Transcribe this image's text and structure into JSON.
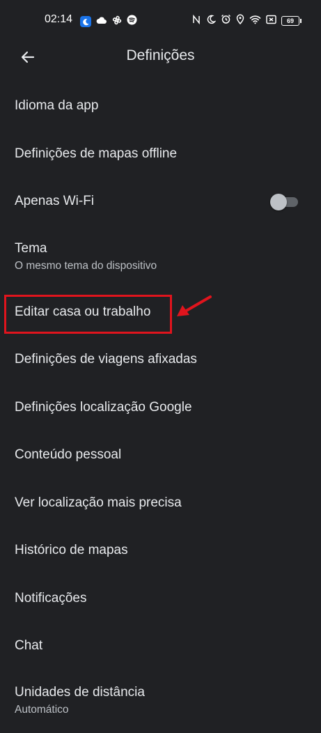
{
  "status_bar": {
    "time": "02:14",
    "battery": "69",
    "left_icons": [
      "moon-icon",
      "cloud-icon",
      "fan-icon",
      "spotify-icon"
    ],
    "right_icons": [
      "nfc-icon",
      "do-not-disturb-icon",
      "alarm-icon",
      "location-icon",
      "wifi-icon",
      "sim-icon",
      "battery-icon"
    ]
  },
  "app_bar": {
    "title": "Definições",
    "back_icon": "arrow-back-icon"
  },
  "settings": {
    "items": [
      {
        "label": "Idioma da app"
      },
      {
        "label": "Definições de mapas offline"
      },
      {
        "label": "Apenas Wi-Fi",
        "toggle": false
      },
      {
        "label": "Tema",
        "subtitle": "O mesmo tema do dispositivo"
      },
      {
        "label": "Editar casa ou trabalho"
      },
      {
        "label": "Definições de viagens afixadas"
      },
      {
        "label": "Definições localização Google"
      },
      {
        "label": "Conteúdo pessoal"
      },
      {
        "label": "Ver localização mais precisa"
      },
      {
        "label": "Histórico de mapas"
      },
      {
        "label": "Notificações"
      },
      {
        "label": "Chat"
      },
      {
        "label": "Unidades de distância",
        "subtitle": "Automático"
      }
    ]
  },
  "annotation": {
    "color": "#e0141d",
    "highlighted_item": "Editar casa ou trabalho"
  }
}
